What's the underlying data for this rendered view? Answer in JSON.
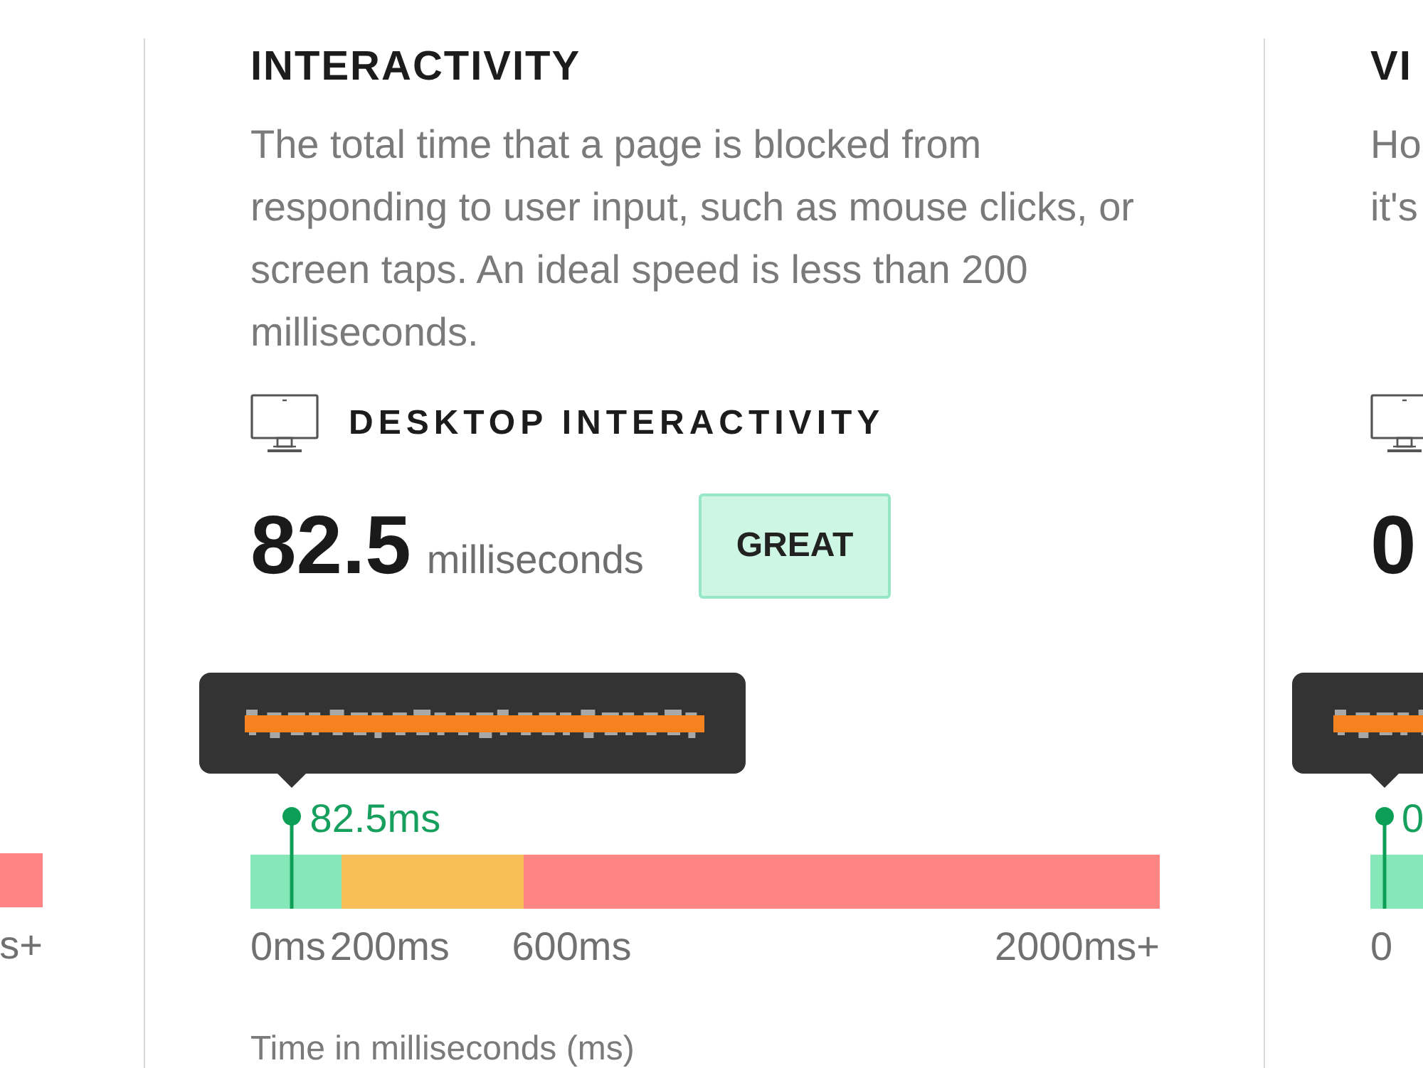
{
  "left_panel": {
    "scale": {
      "segments": [
        {
          "kind": "high",
          "color": "#ff8585"
        }
      ],
      "ticks": [
        {
          "label": "s+",
          "kind": "end"
        }
      ]
    }
  },
  "main_panel": {
    "title": "INTERACTIVITY",
    "description": "The total time that a page is blocked from responding to user input, such as mouse clicks, or screen taps. An ideal speed is less than 200 milliseconds.",
    "device_label": "DESKTOP INTERACTIVITY",
    "value": "82.5",
    "unit": "milliseconds",
    "rating": {
      "label": "GREAT",
      "kind": "good"
    },
    "scale": {
      "tooltip": {
        "kind": "redacted"
      },
      "marker": {
        "label": "82.5ms",
        "level": 0.045
      },
      "segments": [
        {
          "kind": "low",
          "color": "#86e8b9"
        },
        {
          "kind": "mid",
          "color": "#f7bd57"
        },
        {
          "kind": "high",
          "color": "#ff8585"
        }
      ],
      "ticks": [
        {
          "label": "0ms",
          "kind": "start"
        },
        {
          "label": "200ms",
          "kind": "boundary"
        },
        {
          "label": "600ms",
          "kind": "boundary"
        },
        {
          "label": "2000ms+",
          "kind": "end"
        }
      ]
    },
    "caption": "Time in milliseconds (ms)"
  },
  "right_panel": {
    "title": "VI",
    "description": "Ho it's",
    "value": "0",
    "scale": {
      "tooltip": {
        "kind": "redacted"
      },
      "marker": {
        "label": "0"
      },
      "segments": [
        {
          "kind": "low",
          "color": "#86e8b9"
        }
      ],
      "ticks": [
        {
          "label": "0",
          "kind": "start"
        }
      ]
    }
  }
}
